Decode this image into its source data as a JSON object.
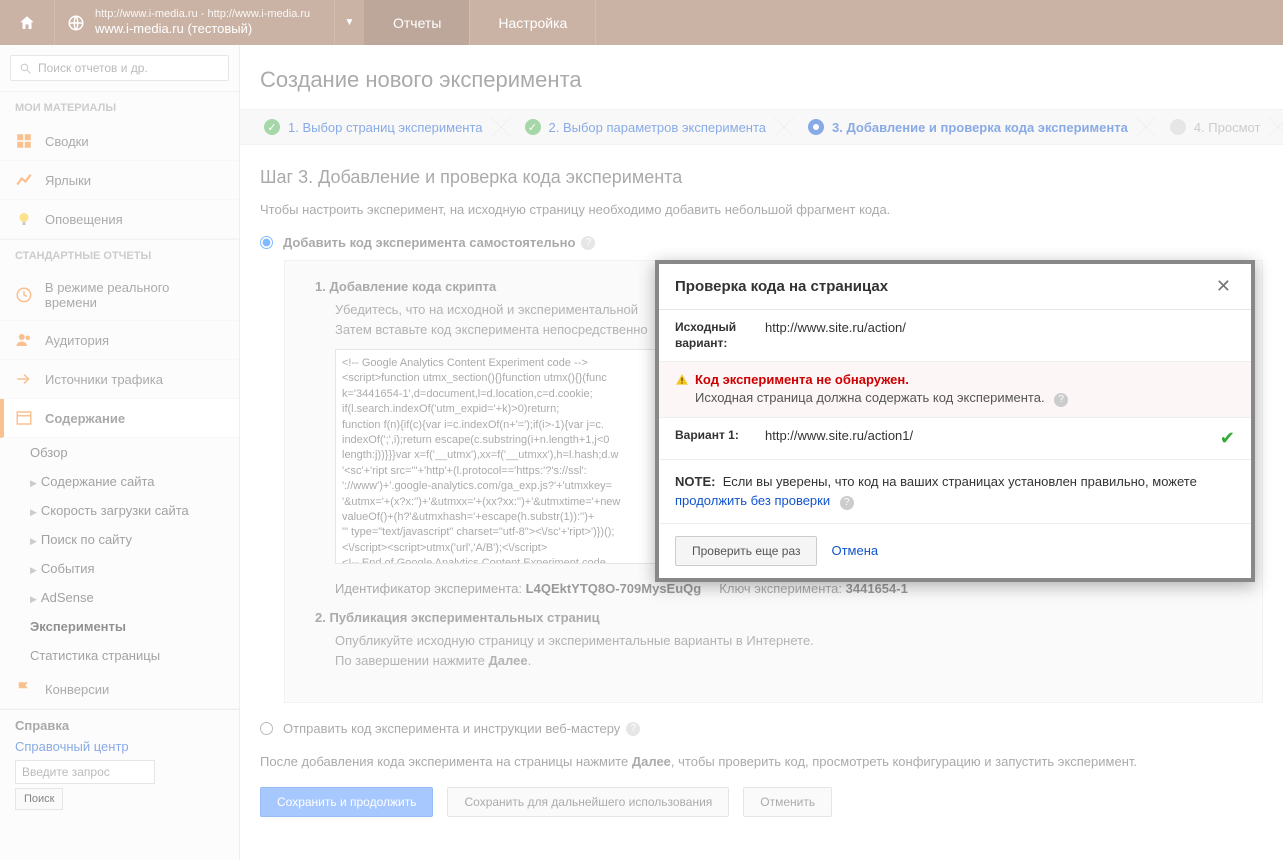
{
  "header": {
    "site_line1": "http://www.i-media.ru - http://www.i-media.ru",
    "site_line2": "www.i-media.ru (тестовый)",
    "tab_reports": "Отчеты",
    "tab_settings": "Настройка"
  },
  "sidebar": {
    "search_placeholder": "Поиск отчетов и др.",
    "sec_my": "МОИ МАТЕРИАЛЫ",
    "my": {
      "summaries": "Сводки",
      "labels": "Ярлыки",
      "alerts": "Оповещения"
    },
    "sec_std": "СТАНДАРТНЫЕ ОТЧЕТЫ",
    "std": {
      "realtime": "В режиме реального времени",
      "audience": "Аудитория",
      "traffic": "Источники трафика",
      "content": "Содержание",
      "conversions": "Конверсии"
    },
    "content_sub": {
      "overview": "Обзор",
      "site_content": "Содержание сайта",
      "speed": "Скорость загрузки сайта",
      "site_search": "Поиск по сайту",
      "events": "События",
      "adsense": "AdSense",
      "experiments": "Эксперименты",
      "page_stats": "Статистика страницы"
    },
    "help": {
      "title": "Справка",
      "center": "Справочный центр",
      "placeholder": "Введите запрос",
      "search_btn": "Поиск"
    }
  },
  "page": {
    "title": "Создание нового эксперимента",
    "steps": {
      "s1": "1. Выбор страниц эксперимента",
      "s2": "2. Выбор параметров эксперимента",
      "s3": "3. Добавление и проверка кода эксперимента",
      "s4": "4. Просмот"
    },
    "h3": "Шаг 3. Добавление и проверка кода эксперимента",
    "intro": "Чтобы настроить эксперимент, на исходную страницу необходимо добавить небольшой фрагмент кода.",
    "opt_self": "Добавить код эксперимента самостоятельно",
    "ol1_title": "1.  Добавление кода скрипта",
    "ol1_body": "Убедитесь, что на исходной и экспериментальной\nЗатем вставьте код эксперимента непосредственно",
    "code": "<!-- Google Analytics Content Experiment code -->\n<script>function utmx_section(){}function utmx(){}(func\nk='3441654-1',d=document,l=d.location,c=d.cookie;\nif(l.search.indexOf('utm_expid='+k)>0)return;\nfunction f(n){if(c){var i=c.indexOf(n+'=');if(i>-1){var j=c.\nindexOf(';',i);return escape(c.substring(i+n.length+1,j<0\nlength:j))}}}var x=f('__utmx'),xx=f('__utmxx'),h=l.hash;d.w\n'<sc'+'ript src=\"'+'http'+(l.protocol=='https:'?'s://ssl':\n'://www')+'.google-analytics.com/ga_exp.js?'+'utmxkey=\n'&utmx='+(x?x:'')+'&utmxx='+(xx?xx:'')+'&utmxtime='+new\nvalueOf()+(h?'&utmxhash='+escape(h.substr(1)):'')+\n'\" type=\"text/javascript\" charset=\"utf-8\"><\\/sc'+'ript>')})();\n<\\/script><script>utmx('url','A/B');<\\/script>\n<!-- End of Google Analytics Content Experiment code",
    "exp_id_label": "Идентификатор эксперимента:",
    "exp_id_val": "L4QEktYTQ8O-709MysEuQg",
    "exp_key_label": "Ключ эксперимента:",
    "exp_key_val": "3441654-1",
    "ol2_title": "2.  Публикация экспериментальных страниц",
    "ol2_body1": "Опубликуйте исходную страницу и экспериментальные варианты в Интернете.",
    "ol2_body2a": "По завершении нажмите ",
    "ol2_body2b": "Далее",
    "opt_send": "Отправить код эксперимента и инструкции веб-мастеру",
    "after_a": "После добавления кода эксперимента на страницы нажмите ",
    "after_b": "Далее",
    "after_c": ", чтобы проверить код, просмотреть конфигурацию и запустить эксперимент.",
    "btn_save": "Сохранить и продолжить",
    "btn_later": "Сохранить для дальнейшего использования",
    "btn_cancel": "Отменить"
  },
  "modal": {
    "title": "Проверка кода на страницах",
    "orig_label": "Исходный вариант:",
    "orig_url": "http://www.site.ru/action/",
    "err_title": "Код эксперимента не обнаружен.",
    "err_desc": "Исходная страница должна содержать код эксперимента.",
    "var1_label": "Вариант 1:",
    "var1_url": "http://www.site.ru/action1/",
    "note_label": "NOTE:",
    "note_text": "Если вы уверены, что код на ваших страницах установлен правильно, можете ",
    "note_link": "продолжить без проверки",
    "btn_retry": "Проверить еще раз",
    "btn_cancel": "Отмена"
  }
}
